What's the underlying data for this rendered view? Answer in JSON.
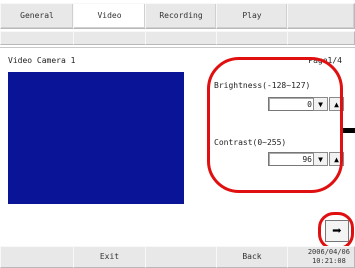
{
  "tabs": [
    {
      "label": "General"
    },
    {
      "label": "Video"
    },
    {
      "label": "Recording"
    },
    {
      "label": "Play"
    }
  ],
  "active_tab": "Video",
  "section": {
    "title": "Video Camera 1",
    "page": "Page1/4"
  },
  "video_preview": {
    "color": "#0a1496"
  },
  "brightness": {
    "label": "Brightness(-128~127)",
    "value": "0"
  },
  "contrast": {
    "label": "Contrast(0~255)",
    "value": "96"
  },
  "stepper_icons": {
    "down": "▼",
    "up": "▲"
  },
  "next_button": {
    "icon": "➡",
    "icon_name": "right-arrow-icon"
  },
  "bottom_bar": {
    "exit_label": "Exit",
    "back_label": "Back",
    "date": "2006/04/06",
    "time": "10:21:08"
  },
  "annotation_color": "#e01010"
}
